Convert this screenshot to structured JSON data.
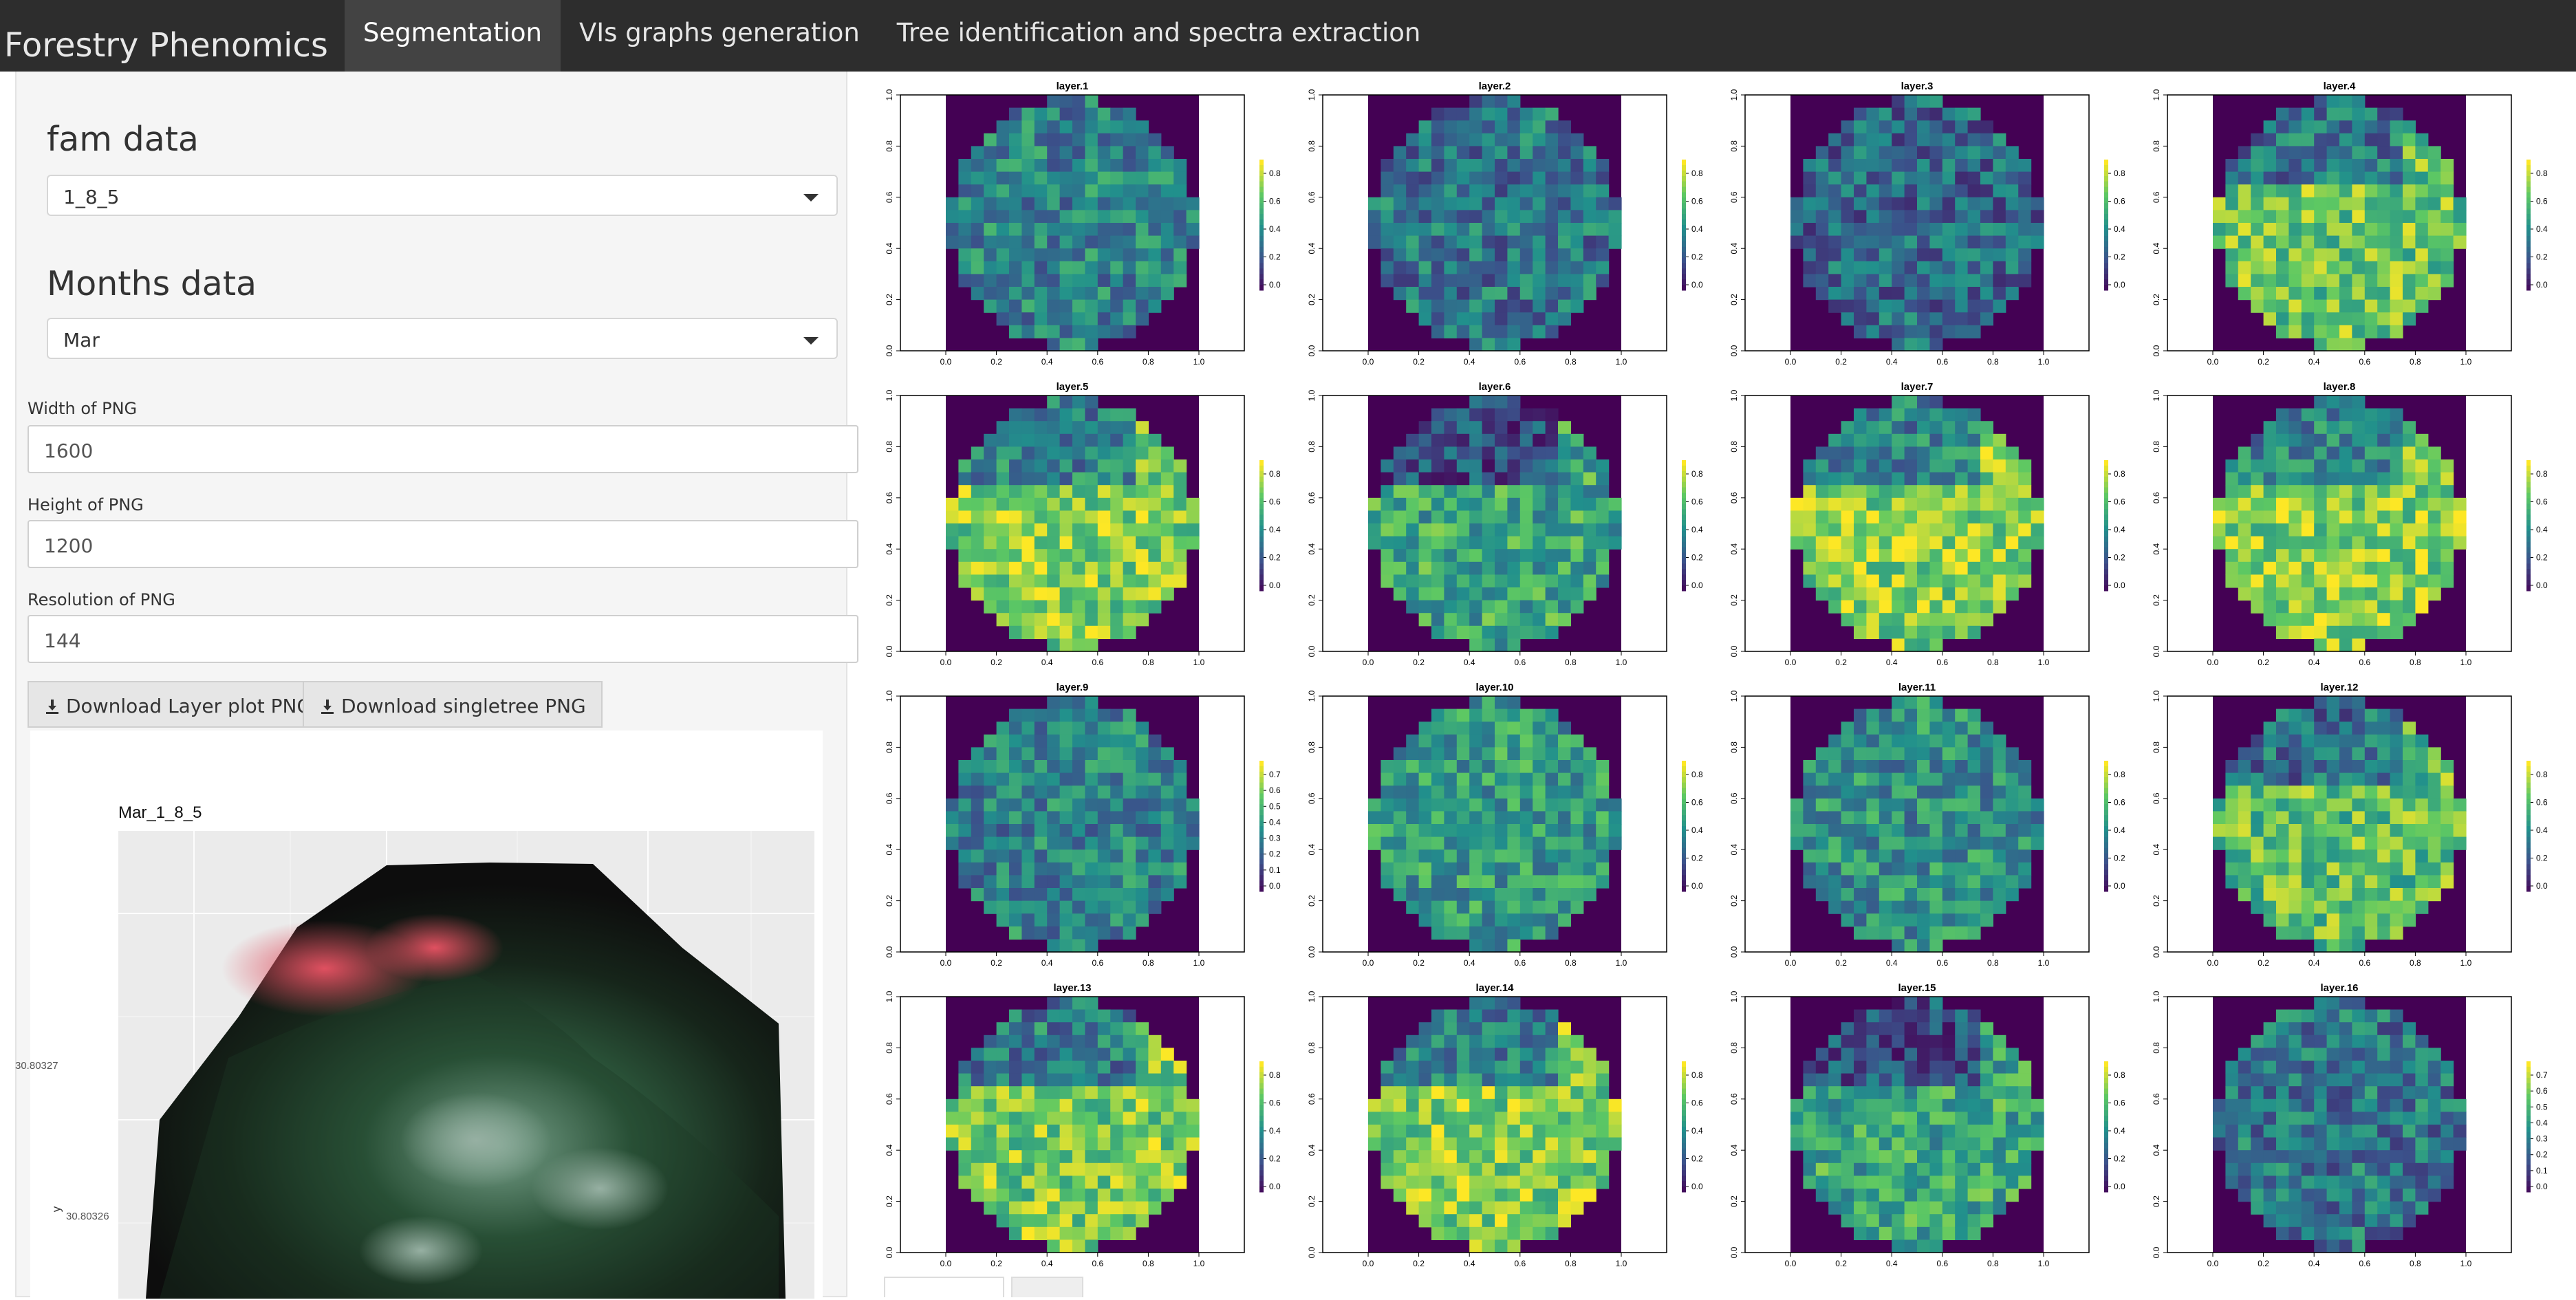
{
  "navbar": {
    "brand": "Forestry Phenomics",
    "tabs": [
      {
        "label": "Segmentation",
        "active": true
      },
      {
        "label": "VIs graphs generation",
        "active": false
      },
      {
        "label": "Tree identification and spectra extraction",
        "active": false
      }
    ]
  },
  "sidebar": {
    "fam_title": "fam data",
    "fam_value": "1_8_5",
    "months_title": "Months data",
    "months_value": "Mar",
    "width_label": "Width of PNG",
    "width_value": "1600",
    "height_label": "Height of PNG",
    "height_value": "1200",
    "resolution_label": "Resolution of PNG",
    "resolution_value": "144",
    "download_layer_label": "Download Layer plot PNG",
    "download_single_label": "Download singletree PNG"
  },
  "tree_plot": {
    "title": "Mar_1_8_5",
    "y_ticks": [
      "30.80327",
      "30.80326"
    ],
    "ylabel": "y"
  },
  "chart_data": {
    "type": "heatmap",
    "layers": [
      "layer.1",
      "layer.2",
      "layer.3",
      "layer.4",
      "layer.5",
      "layer.6",
      "layer.7",
      "layer.8",
      "layer.9",
      "layer.10",
      "layer.11",
      "layer.12",
      "layer.13",
      "layer.14",
      "layer.15",
      "layer.16"
    ],
    "x_ticks": [
      "0.0",
      "0.2",
      "0.4",
      "0.6",
      "0.8",
      "1.0"
    ],
    "y_ticks": [
      "0.0",
      "0.2",
      "0.4",
      "0.6",
      "0.8",
      "1.0"
    ],
    "colorbar_ticks": [
      "0.0",
      "0.2",
      "0.4",
      "0.6",
      "0.8"
    ],
    "colorbar_ticks_alt": [
      "0.0",
      "0.1",
      "0.2",
      "0.3",
      "0.4",
      "0.5",
      "0.6",
      "0.7"
    ],
    "alt_colorbar_layers": [
      9,
      16
    ],
    "xlim": [
      0,
      1
    ],
    "ylim": [
      0,
      1
    ],
    "colormap": [
      "#440154",
      "#3b528b",
      "#21908c",
      "#5dc863",
      "#fde725"
    ]
  }
}
